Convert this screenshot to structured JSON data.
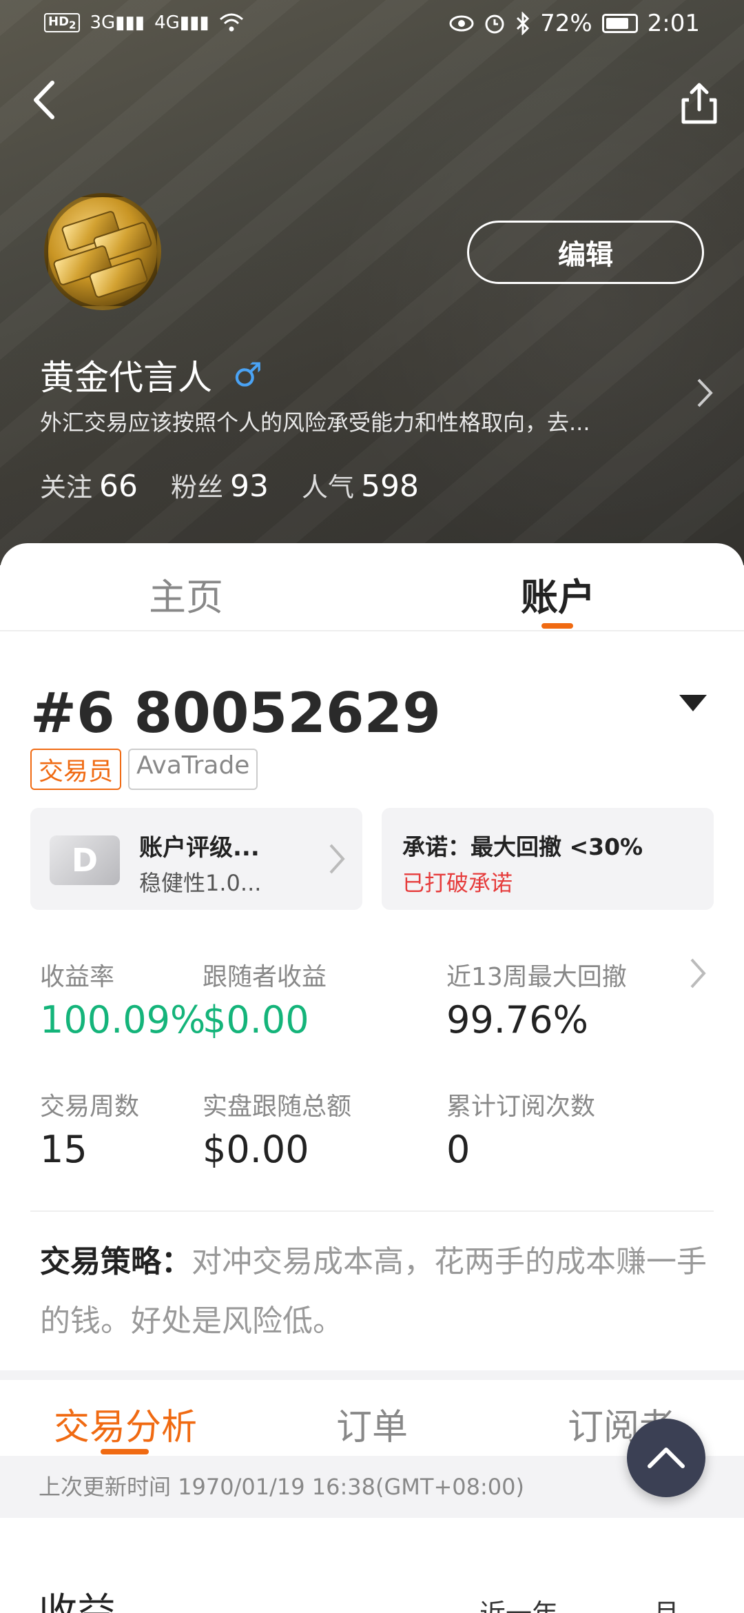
{
  "status_bar": {
    "left_badge": "HD",
    "left_badge_sub": "2",
    "signal1": "3G",
    "signal2": "4G",
    "battery": "72%",
    "time": "2:01",
    "icons": [
      "eye-icon",
      "alarm-icon",
      "bluetooth-icon",
      "battery-icon",
      "wifi-icon"
    ]
  },
  "header": {
    "edit_label": "编辑"
  },
  "profile": {
    "name": "黄金代言人",
    "gender_symbol": "♂",
    "bio": "外汇交易应该按照个人的风险承受能力和性格取向，去...",
    "stats": [
      {
        "label": "关注",
        "value": "66"
      },
      {
        "label": "粉丝",
        "value": "93"
      },
      {
        "label": "人气",
        "value": "598"
      }
    ]
  },
  "tabs": [
    {
      "label": "主页",
      "active": false
    },
    {
      "label": "账户",
      "active": true
    }
  ],
  "account": {
    "number": "#6 80052629",
    "tags": [
      "交易员",
      "AvaTrade"
    ],
    "rating": {
      "grade": "D",
      "title": "账户评级...",
      "subtitle": "稳健性1.0..."
    },
    "promise": {
      "title": "承诺：最大回撤 <30%",
      "status": "已打破承诺"
    },
    "metrics": [
      {
        "label": "收益率",
        "value": "100.09%",
        "highlight": true
      },
      {
        "label": "跟随者收益",
        "value": "$0.00",
        "highlight": true
      },
      {
        "label": "近13周最大回撤",
        "value": "99.76%",
        "highlight": false
      },
      {
        "label": "交易周数",
        "value": "15",
        "highlight": false
      },
      {
        "label": "实盘跟随总额",
        "value": "$0.00",
        "highlight": false
      },
      {
        "label": "累计订阅次数",
        "value": "0",
        "highlight": false
      }
    ],
    "strategy_label": "交易策略：",
    "strategy_text": "对冲交易成本高，花两手的成本赚一手的钱。好处是风险低。"
  },
  "sub_tabs": [
    {
      "label": "交易分析",
      "active": true
    },
    {
      "label": "订单",
      "active": false
    },
    {
      "label": "订阅者",
      "active": false
    }
  ],
  "last_updated": "上次更新时间 1970/01/19 16:38(GMT+08:00)",
  "bottom": {
    "heading": "收益",
    "filter1": "近一年",
    "filter2": "月"
  },
  "colors": {
    "accent": "#f06a12",
    "positive": "#14b47a",
    "danger": "#e63b3b",
    "fab": "#3b4054"
  }
}
